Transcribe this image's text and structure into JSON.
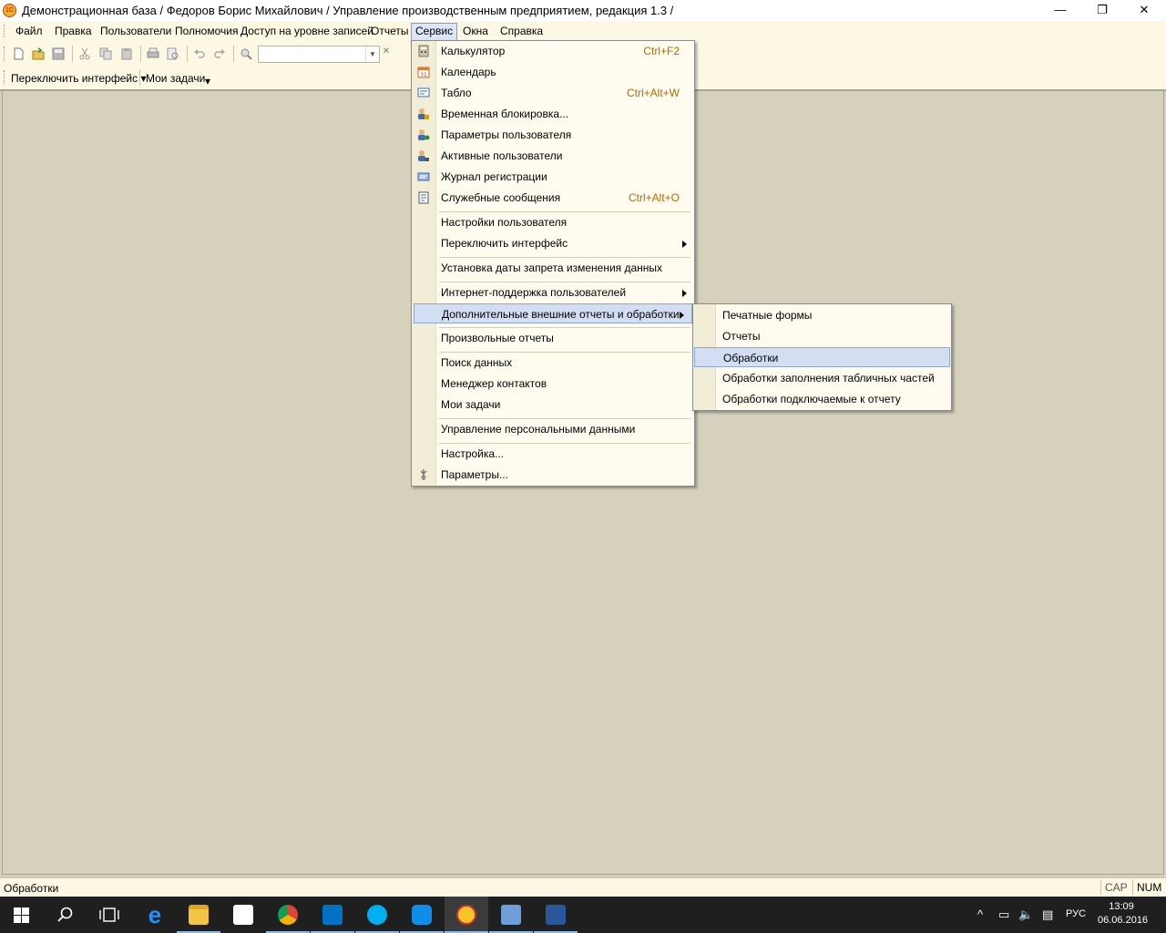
{
  "window": {
    "title": "Демонстрационная база / Федоров Борис Михайлович /  Управление производственным предприятием, редакция 1.3 /",
    "logo_text": "1С",
    "controls": {
      "minimize": "—",
      "restore": "❐",
      "close": "✕"
    }
  },
  "menubar": {
    "items": [
      "Файл",
      "Правка",
      "Пользователи",
      "Полномочия",
      "Доступ на уровне записей",
      "Отчеты",
      "Сервис",
      "Окна",
      "Справка"
    ],
    "active": "Сервис"
  },
  "toolbar": {
    "buttons": [
      "new-document-icon",
      "open-icon",
      "save-icon",
      "cut-icon",
      "copy-icon",
      "paste-icon",
      "print-icon",
      "print-preview-icon",
      "undo-icon",
      "redo-icon",
      "find-icon"
    ],
    "search_value": "",
    "combo_arrow": "▼",
    "clear": "✕"
  },
  "panelbar": {
    "switch_interface": "Переключить интерфейс",
    "switch_arrow": "▾",
    "my_tasks": "Мои задачи",
    "my_tasks_arrow": "▾"
  },
  "service_menu": {
    "items": [
      {
        "label": "Калькулятор",
        "shortcut": "Ctrl+F2",
        "icon": "calculator-icon"
      },
      {
        "label": "Календарь",
        "shortcut": "",
        "icon": "calendar-icon"
      },
      {
        "label": "Табло",
        "shortcut": "Ctrl+Alt+W",
        "icon": "scoreboard-icon"
      },
      {
        "label": "Временная блокировка...",
        "shortcut": "",
        "icon": "lock-user-icon"
      },
      {
        "label": "Параметры пользователя",
        "shortcut": "",
        "icon": "user-settings-icon"
      },
      {
        "label": "Активные пользователи",
        "shortcut": "",
        "icon": "active-users-icon"
      },
      {
        "label": "Журнал регистрации",
        "shortcut": "",
        "icon": "event-log-icon"
      },
      {
        "label": "Служебные сообщения",
        "shortcut": "Ctrl+Alt+O",
        "icon": "service-messages-icon"
      },
      {
        "label": "Настройки пользователя",
        "shortcut": ""
      },
      {
        "label": "Переключить интерфейс",
        "shortcut": "",
        "submenu": true
      },
      {
        "label": "Установка даты запрета изменения данных",
        "shortcut": ""
      },
      {
        "label": "Интернет-поддержка пользователей",
        "shortcut": "",
        "submenu": true
      },
      {
        "label": "Дополнительные внешние отчеты и обработки",
        "shortcut": "",
        "submenu": true,
        "highlighted": true
      },
      {
        "label": "Произвольные отчеты",
        "shortcut": ""
      },
      {
        "label": "Поиск данных",
        "shortcut": ""
      },
      {
        "label": "Менеджер контактов",
        "shortcut": ""
      },
      {
        "label": "Мои задачи",
        "shortcut": ""
      },
      {
        "label": "Управление персональными данными",
        "shortcut": ""
      },
      {
        "label": "Настройка...",
        "shortcut": ""
      },
      {
        "label": "Параметры...",
        "shortcut": "",
        "icon": "parameters-icon"
      }
    ]
  },
  "submenu": {
    "items": [
      {
        "label": "Печатные формы"
      },
      {
        "label": "Отчеты"
      },
      {
        "label": "Обработки",
        "highlighted": true
      },
      {
        "label": "Обработки заполнения табличных частей"
      },
      {
        "label": "Обработки подключаемые к отчету"
      }
    ]
  },
  "statusbar": {
    "text": "Обработки",
    "cap": "CAP",
    "num": "NUM"
  },
  "taskbar": {
    "apps": [
      "start-icon",
      "search-icon",
      "task-view-icon",
      "edge-icon",
      "explorer-icon",
      "store-icon",
      "chrome-icon",
      "outlook-icon",
      "skype-icon",
      "teamviewer-icon",
      "1c-icon",
      "network-admin-icon",
      "word-icon"
    ],
    "language": "РУС",
    "time": "13:09",
    "date": "06.06.2016",
    "tray": {
      "chevron": "^",
      "network": "▭",
      "volume": "🔈",
      "notifications": "▤"
    }
  },
  "colors": {
    "accent_highlight": "#d3def3",
    "menu_background": "#fffcef",
    "workspace": "#d6d1bc",
    "shortcut_text": "#b06b00"
  }
}
